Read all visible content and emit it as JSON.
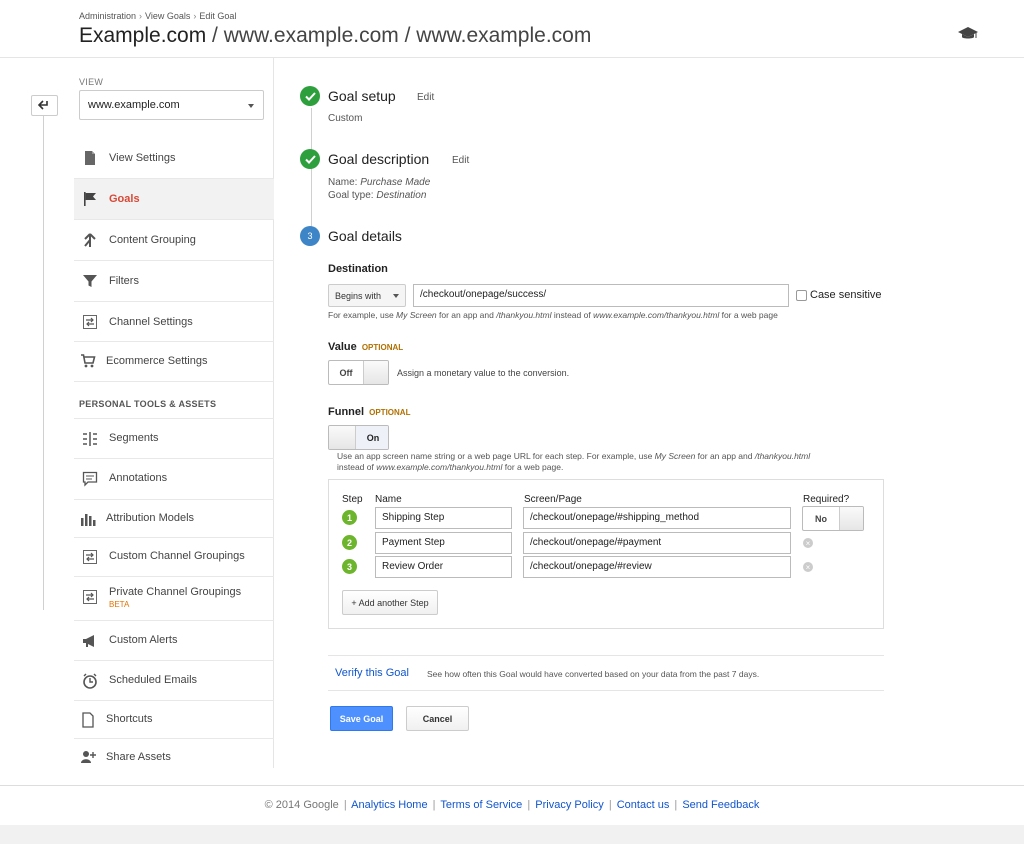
{
  "breadcrumb": [
    "Administration",
    "View Goals",
    "Edit Goal"
  ],
  "breadcrumb_sep": "›",
  "title": {
    "main": "Example.com",
    "rest": " / www.example.com / www.example.com"
  },
  "sidebar": {
    "view_label": "VIEW",
    "view_value": "www.example.com",
    "items": [
      {
        "label": "View Settings",
        "icon": "document-icon"
      },
      {
        "label": "Goals",
        "icon": "flag-icon"
      },
      {
        "label": "Content Grouping",
        "icon": "merge-icon"
      },
      {
        "label": "Filters",
        "icon": "filter-icon"
      },
      {
        "label": "Channel Settings",
        "icon": "channel-icon"
      },
      {
        "label": "Ecommerce Settings",
        "icon": "cart-icon"
      }
    ],
    "personal_head": "PERSONAL TOOLS & ASSETS",
    "personal_items": [
      {
        "label": "Segments",
        "icon": "segments-icon"
      },
      {
        "label": "Annotations",
        "icon": "comment-icon"
      },
      {
        "label": "Attribution Models",
        "icon": "bar-chart-icon"
      },
      {
        "label": "Custom Channel Groupings",
        "icon": "channel-icon"
      },
      {
        "label": "Private Channel Groupings",
        "icon": "channel-icon",
        "badge": "BETA"
      },
      {
        "label": "Custom Alerts",
        "icon": "megaphone-icon"
      },
      {
        "label": "Scheduled Emails",
        "icon": "clock-icon"
      },
      {
        "label": "Shortcuts",
        "icon": "shortcut-icon"
      },
      {
        "label": "Share Assets",
        "icon": "share-user-icon"
      }
    ]
  },
  "steps": {
    "setup": {
      "title": "Goal setup",
      "edit": "Edit",
      "sub": "Custom"
    },
    "description": {
      "title": "Goal description",
      "edit": "Edit",
      "name_label": "Name: ",
      "name_value": "Purchase Made",
      "type_label": "Goal type: ",
      "type_value": "Destination"
    },
    "details": {
      "number": "3",
      "title": "Goal details"
    }
  },
  "destination": {
    "label": "Destination",
    "match_type": "Begins with",
    "value": "/checkout/onepage/success/",
    "case_sensitive": "Case sensitive",
    "hint_parts": [
      "For example, use ",
      "My Screen",
      " for an app and ",
      "/thankyou.html",
      " instead of ",
      "www.example.com/thankyou.html",
      " for a web page"
    ]
  },
  "value_field": {
    "label": "Value",
    "optional": "OPTIONAL",
    "toggle": "Off",
    "desc": "Assign a monetary value to the conversion."
  },
  "funnel": {
    "label": "Funnel",
    "optional": "OPTIONAL",
    "toggle": "On",
    "hint_line1_parts": [
      "Use an app screen name string or a web page URL for each step. For example, use ",
      "My Screen",
      " for an app and ",
      "/thankyou.html"
    ],
    "hint_line2_parts": [
      "instead of ",
      "www.example.com/thankyou.html",
      " for a web page."
    ],
    "headers": {
      "step": "Step",
      "name": "Name",
      "screen": "Screen/Page",
      "required": "Required?"
    },
    "rows": [
      {
        "num": "1",
        "name": "Shipping Step",
        "page": "/checkout/onepage/#shipping_method"
      },
      {
        "num": "2",
        "name": "Payment Step",
        "page": "/checkout/onepage/#payment"
      },
      {
        "num": "3",
        "name": "Review Order",
        "page": "/checkout/onepage/#review"
      }
    ],
    "required_toggle": "No",
    "add_step": "+ Add another Step"
  },
  "verify": {
    "link": "Verify this Goal",
    "desc": "See how often this Goal would have converted based on your data from the past 7 days."
  },
  "buttons": {
    "save": "Save Goal",
    "cancel": "Cancel"
  },
  "footer": {
    "copyright": "© 2014 Google",
    "links": [
      "Analytics Home",
      "Terms of Service",
      "Privacy Policy",
      "Contact us",
      "Send Feedback"
    ]
  },
  "colors": {
    "accent_red": "#d64937",
    "check_green": "#2d9f3d",
    "step_blue": "#3d85c6",
    "link_blue": "#1155cc",
    "primary_button": "#4d90fe"
  }
}
